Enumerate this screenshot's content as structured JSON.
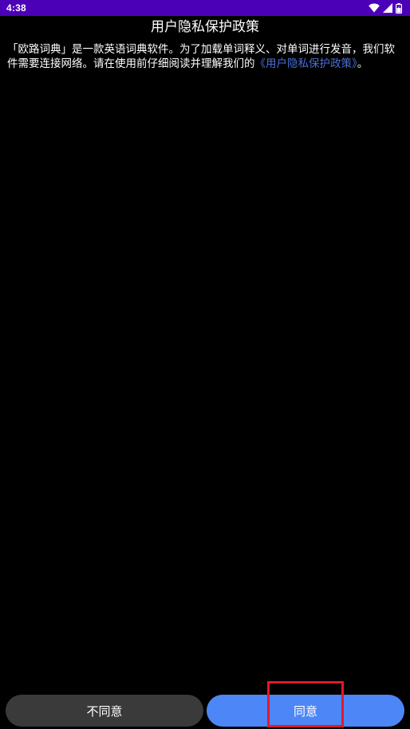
{
  "status_bar": {
    "time": "4:38",
    "background_color": "#4b00b8",
    "icons": [
      "wifi-icon",
      "signal-icon",
      "battery-icon"
    ]
  },
  "page": {
    "title": "用户隐私保护政策",
    "body_text": "「欧路词典」是一款英语词典软件。为了加载单词释义、对单词进行发音，我们软件需要连接网络。请在使用前仔细阅读并理解我们的",
    "policy_link_text": "《用户隐私保护政策》",
    "body_suffix": "。",
    "link_color": "#4a6fd8"
  },
  "buttons": {
    "disagree_label": "不同意",
    "agree_label": "同意",
    "disagree_color": "#3a3a3a",
    "agree_color": "#4d86f7"
  },
  "highlight": {
    "color": "#e0192a"
  }
}
